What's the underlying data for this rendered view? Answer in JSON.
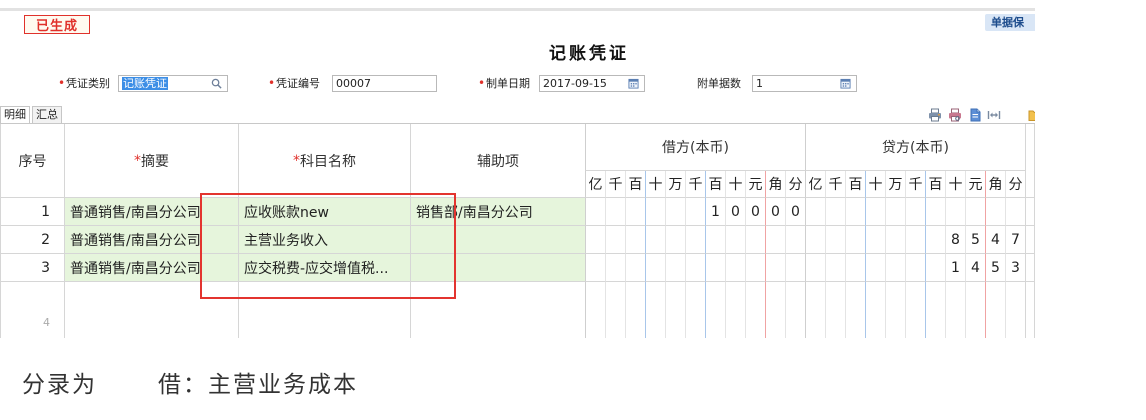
{
  "status_badge": "已生成",
  "top_button": "单据保",
  "title": "记账凭证",
  "fields": {
    "required_mark": "•",
    "voucher_type": {
      "label": "凭证类别",
      "value": "记账凭证"
    },
    "voucher_no": {
      "label": "凭证编号",
      "value": "00007"
    },
    "date": {
      "label": "制单日期",
      "value": "2017-09-15"
    },
    "attachments": {
      "label": "附单据数",
      "value": "1"
    }
  },
  "tabs": [
    {
      "label": "明细",
      "active": true
    },
    {
      "label": "汇总",
      "active": false
    }
  ],
  "icons": {
    "field_search": "search-icon",
    "field_calendar": "calendar-icon",
    "toolbar": [
      "print-icon",
      "print-preview-icon",
      "export-icon",
      "expand-columns-icon",
      "toolbar-more-icon"
    ]
  },
  "table": {
    "required_mark": "*",
    "headers": {
      "seq": "序号",
      "summary": "摘要",
      "account": "科目名称",
      "aux": "辅助项",
      "debit": "借方(本币)",
      "credit": "贷方(本币)"
    },
    "digit_labels": [
      "亿",
      "千",
      "百",
      "十",
      "万",
      "千",
      "百",
      "十",
      "元",
      "角",
      "分"
    ],
    "rows": [
      {
        "seq": "1",
        "summary": "普通销售/南昌分公司",
        "account": "应收账款new",
        "aux": "销售部/南昌分公司",
        "debit_digits": [
          "1",
          "0",
          "0",
          "0",
          "0"
        ]
      },
      {
        "seq": "2",
        "summary": "普通销售/南昌分公司",
        "account": "主营业务收入",
        "credit_digits": [
          "8",
          "5",
          "4",
          "7"
        ]
      },
      {
        "seq": "3",
        "summary": "普通销售/南昌分公司",
        "account": "应交税费-应交增值税...",
        "credit_digits": [
          "1",
          "4",
          "5",
          "3"
        ]
      },
      {
        "seq": "4"
      }
    ]
  },
  "note": {
    "prefix": "分录为",
    "entry": "借：主营业务成本"
  },
  "colors": {
    "accent_red": "#e0312b",
    "row_green": "#e6f5dc",
    "selection_blue": "#3c8ee6",
    "group_line_blue": "#a8c6ea",
    "decimal_line_red": "#f0a3a3",
    "highlight_box": "#e3342f"
  }
}
